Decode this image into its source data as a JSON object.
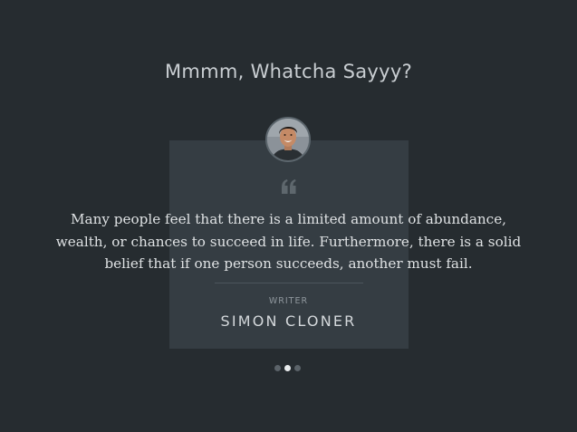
{
  "section": {
    "title": "Mmmm, Whatcha Sayyy?"
  },
  "testimonial": {
    "avatar_alt": "avatar",
    "quote_icon": "quote-icon",
    "quote": "Many people feel that there is a limited amount of abundance, wealth, or chances to succeed in life. Furthermore, there is a solid belief that if one person succeeds, another must fail.",
    "author_role": "WRITER",
    "author_name": "SIMON CLONER"
  },
  "pager": {
    "count": 3,
    "active_index": 1
  },
  "colors": {
    "background": "#262c30",
    "card": "#353d43",
    "active_dot": "#e9ecee",
    "inactive_dot": "#5b6369"
  }
}
